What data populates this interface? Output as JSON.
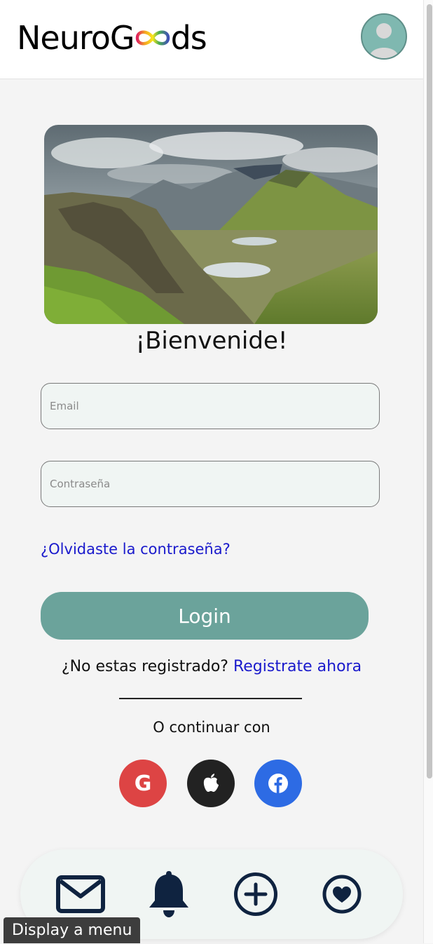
{
  "header": {
    "logo_text_before": "NeuroG",
    "logo_text_after": "ds"
  },
  "hero": {
    "image_description_icon": "landscape-image"
  },
  "welcome": "¡Bienvenide!",
  "form": {
    "email_placeholder": "Email",
    "password_placeholder": "Contraseña",
    "forgot_password": "¿Olvidaste la contraseña?",
    "login_label": "Login",
    "not_registered": "¿No estas registrado?",
    "register_link": "Registrate ahora",
    "continue_with": "O continuar con"
  },
  "social": [
    {
      "name": "google",
      "glyph": "G",
      "color": "#dd4444"
    },
    {
      "name": "apple",
      "color": "#222222"
    },
    {
      "name": "facebook",
      "color": "#2d6be4"
    }
  ],
  "bottom_nav": {
    "icons": [
      "mail-icon",
      "bell-icon",
      "plus-circle-icon",
      "heart-circle-icon"
    ],
    "icon_color": "#0f2340"
  },
  "tooltip": "Display a menu"
}
